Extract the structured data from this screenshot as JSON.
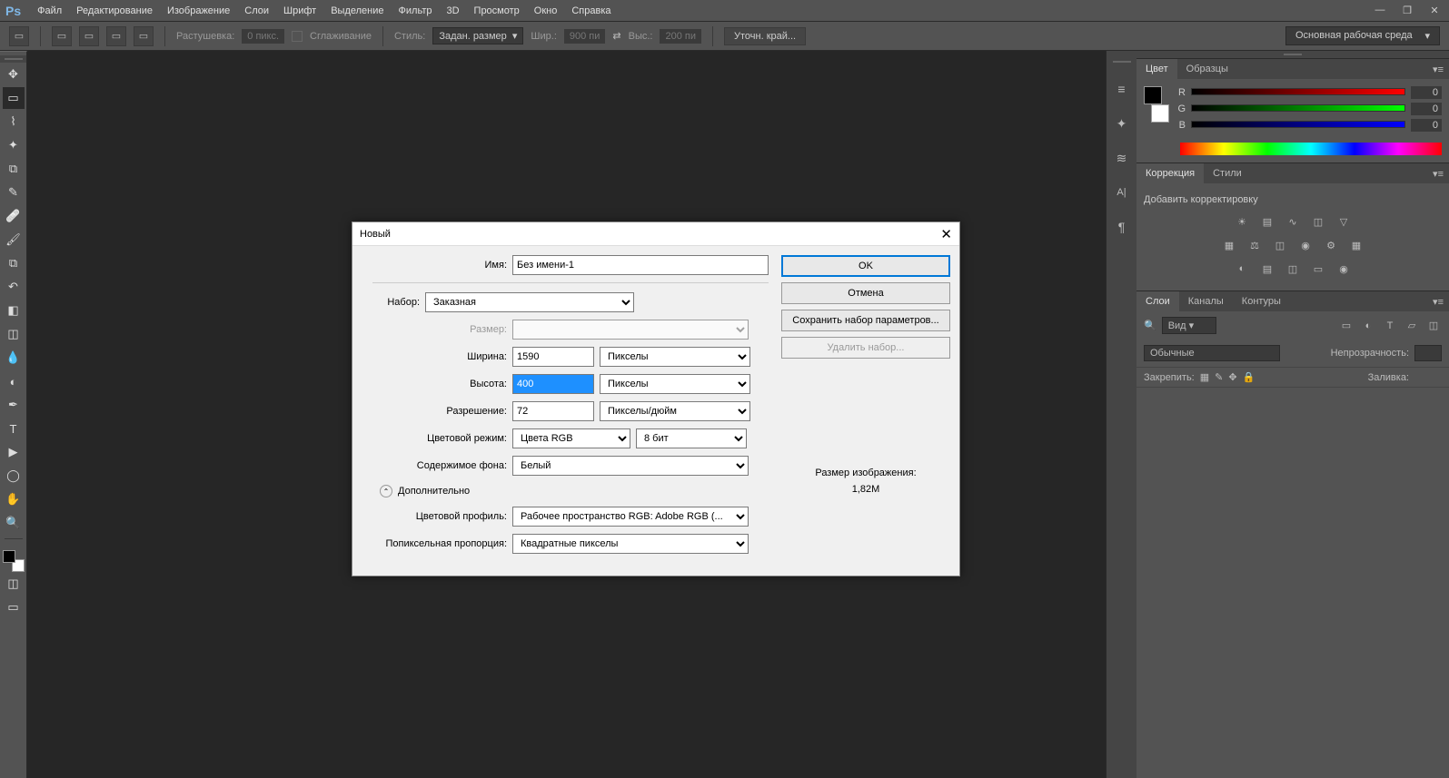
{
  "app": {
    "logo": "Ps"
  },
  "menu": [
    "Файл",
    "Редактирование",
    "Изображение",
    "Слои",
    "Шрифт",
    "Выделение",
    "Фильтр",
    "3D",
    "Просмотр",
    "Окно",
    "Справка"
  ],
  "optbar": {
    "feather_label": "Растушевка:",
    "feather_value": "0 пикс.",
    "antialias": "Сглаживание",
    "style_label": "Стиль:",
    "style_value": "Задан. размер",
    "width_label": "Шир.:",
    "width_value": "900 пи",
    "height_label": "Выс.:",
    "height_value": "200 пи",
    "refine": "Уточн. край...",
    "workspace": "Основная рабочая среда"
  },
  "panels": {
    "color_tab": "Цвет",
    "samples_tab": "Образцы",
    "r": "R",
    "g": "G",
    "b": "B",
    "rv": "0",
    "gv": "0",
    "bv": "0",
    "adj_tab": "Коррекция",
    "styles_tab": "Стили",
    "adj_title": "Добавить корректировку",
    "layers_tab": "Слои",
    "channels_tab": "Каналы",
    "paths_tab": "Контуры",
    "kind": "Вид",
    "blend": "Обычные",
    "opacity": "Непрозрачность:",
    "lock": "Закрепить:",
    "fill": "Заливка:"
  },
  "dialog": {
    "title": "Новый",
    "name_label": "Имя:",
    "name": "Без имени-1",
    "preset_label": "Набор:",
    "preset": "Заказная",
    "size_label": "Размер:",
    "width_label": "Ширина:",
    "width": "1590",
    "width_unit": "Пикселы",
    "height_label": "Высота:",
    "height": "400",
    "height_unit": "Пикселы",
    "res_label": "Разрешение:",
    "res": "72",
    "res_unit": "Пикселы/дюйм",
    "mode_label": "Цветовой режим:",
    "mode": "Цвета RGB",
    "depth": "8 бит",
    "bg_label": "Содержимое фона:",
    "bg": "Белый",
    "advanced": "Дополнительно",
    "profile_label": "Цветовой профиль:",
    "profile": "Рабочее пространство RGB:  Adobe RGB (...",
    "aspect_label": "Попиксельная пропорция:",
    "aspect": "Квадратные пикселы",
    "ok": "OK",
    "cancel": "Отмена",
    "save": "Сохранить набор параметров...",
    "delete": "Удалить набор...",
    "size_info_label": "Размер изображения:",
    "size_info": "1,82M"
  }
}
